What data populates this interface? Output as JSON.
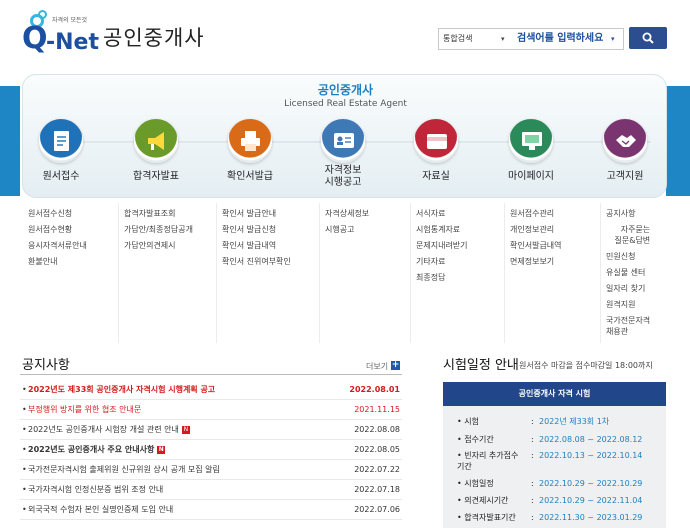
{
  "header": {
    "logo_tagline": "자격의 모든것",
    "logo_q": "Q",
    "logo_net": "-Net",
    "site_title": "공인중개사",
    "search_scope": "통합검색",
    "search_placeholder": "검색어를 입력하세요"
  },
  "hero": {
    "title": "공인중개사",
    "subtitle": "Licensed Real Estate Agent",
    "menus": [
      {
        "label": "원서접수",
        "icon": "document-icon",
        "color": "#1f72b8"
      },
      {
        "label": "합격자발표",
        "icon": "megaphone-icon",
        "color": "#6a9a2a"
      },
      {
        "label": "확인서발급",
        "icon": "printer-icon",
        "color": "#d96a17"
      },
      {
        "label": "자격정보\n시행공고",
        "icon": "id-card-icon",
        "color": "#3f79b5"
      },
      {
        "label": "자료실",
        "icon": "folder-icon",
        "color": "#c0263a"
      },
      {
        "label": "마이페이지",
        "icon": "monitor-icon",
        "color": "#2b8a5a"
      },
      {
        "label": "고객지원",
        "icon": "handshake-icon",
        "color": "#7a3570"
      }
    ]
  },
  "submenus": [
    [
      "원서접수신청",
      "원서접수현황",
      "응시자격서류안내",
      "환불안내"
    ],
    [
      "합격자발표조회",
      "가답안/최종정답공개",
      "가답안의견제시"
    ],
    [
      "확인서 발급안내",
      "확인서 발급신청",
      "확인서 발급내역",
      "확인서 진위여부확인"
    ],
    [
      "자격상세정보",
      "시행공고"
    ],
    [
      "서식자료",
      "시험통계자료",
      "문제지내려받기",
      "기타자료",
      "최종정답"
    ],
    [
      "원서접수관리",
      "개인정보관리",
      "확인서발급내역",
      "면제정보보기"
    ],
    [
      "공지사항",
      "자주묻는\n질문&답변",
      "민원신청",
      "유실물 센터",
      "일자리 찾기",
      "원격지원",
      "국가전문자격\n채용관"
    ]
  ],
  "notice": {
    "title": "공지사항",
    "more": "더보기",
    "items": [
      {
        "text": "2022년도 제33회 공인중개사 자격시험 시행계획 공고",
        "date": "2022.08.01",
        "red": true,
        "new": false
      },
      {
        "text": "부정행위 방지를 위한 협조 안내문",
        "date": "2021.11.15",
        "red": true,
        "new": false
      },
      {
        "text": "2022년도 공인중개사 시험장 개설 관련 안내",
        "date": "2022.08.08",
        "red": false,
        "new": true
      },
      {
        "text": "2022년도 공인중개사 주요 안내사항",
        "date": "2022.08.05",
        "red": false,
        "new": true
      },
      {
        "text": "국가전문자격시험 출제위원 신규위원 상시 공개 모집 알림",
        "date": "2022.07.22",
        "red": false,
        "new": false
      },
      {
        "text": "국가자격시험 인정신분증 범위 조정 안내",
        "date": "2022.07.18",
        "red": false,
        "new": false
      },
      {
        "text": "외국국적 수험자 본인 실명인증제 도입 안내",
        "date": "2022.07.06",
        "red": false,
        "new": false
      }
    ]
  },
  "schedule": {
    "title": "시험일정 안내",
    "note": "원서접수 마감을 접수마감일 18:00까지",
    "box_title": "공인중개사 자격 시험",
    "rows": [
      {
        "label": "시험",
        "value": "2022년 제33회 1차"
      },
      {
        "label": "접수기간",
        "value": "2022.08.08 ~ 2022.08.12"
      },
      {
        "label": "빈자리 추가접수\n기간",
        "value": "2022.10.13 ~ 2022.10.14"
      },
      {
        "label": "시험일정",
        "value": "2022.10.29 ~ 2022.10.29"
      },
      {
        "label": "의견제시기간",
        "value": "2022.10.29 ~ 2022.11.04"
      },
      {
        "label": "합격자발표기간",
        "value": "2022.11.30 ~ 2023.01.29"
      }
    ]
  }
}
